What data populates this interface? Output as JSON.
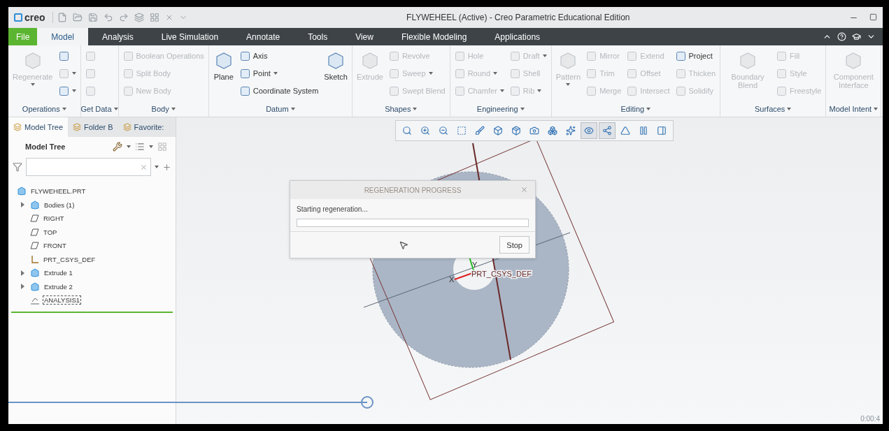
{
  "window": {
    "logo": "creo",
    "title": "FLYWEHEEL (Active) - Creo Parametric Educational Edition"
  },
  "tabs": [
    {
      "label": "File",
      "kind": "file",
      "selected": false
    },
    {
      "label": "Model",
      "kind": "tab",
      "selected": true
    },
    {
      "label": "Analysis",
      "kind": "tab",
      "selected": false
    },
    {
      "label": "Live Simulation",
      "kind": "tab",
      "selected": false
    },
    {
      "label": "Annotate",
      "kind": "tab",
      "selected": false
    },
    {
      "label": "Tools",
      "kind": "tab",
      "selected": false
    },
    {
      "label": "View",
      "kind": "tab",
      "selected": false
    },
    {
      "label": "Flexible Modeling",
      "kind": "tab",
      "selected": false
    },
    {
      "label": "Applications",
      "kind": "tab",
      "selected": false
    }
  ],
  "ribbon": [
    {
      "label": "Operations",
      "columns": [
        [
          {
            "label": "Regenerate",
            "kind": "large",
            "disabled": true,
            "dropdown": true
          }
        ],
        [
          {
            "kind": "icon",
            "disabled": false,
            "dropdown": false
          },
          {
            "kind": "icon",
            "disabled": true,
            "dropdown": true
          },
          {
            "kind": "icon",
            "disabled": false,
            "dropdown": true
          }
        ]
      ]
    },
    {
      "label": "Get Data",
      "columns": [
        [
          {
            "kind": "icon",
            "disabled": true,
            "dropdown": false
          },
          {
            "kind": "icon",
            "disabled": true,
            "dropdown": false
          },
          {
            "kind": "icon",
            "disabled": true,
            "dropdown": false
          }
        ]
      ]
    },
    {
      "label": "Body",
      "columns": [
        [
          {
            "label": "Boolean Operations",
            "kind": "small",
            "disabled": true,
            "dropdown": false
          },
          {
            "label": "Split Body",
            "kind": "small",
            "disabled": true,
            "dropdown": false
          },
          {
            "label": "New Body",
            "kind": "small",
            "disabled": true,
            "dropdown": false
          }
        ]
      ]
    },
    {
      "label": "Datum",
      "columns": [
        [
          {
            "label": "Plane",
            "kind": "large",
            "disabled": false,
            "dropdown": false
          }
        ],
        [
          {
            "label": "Axis",
            "kind": "small",
            "disabled": false,
            "dropdown": false
          },
          {
            "label": "Point",
            "kind": "small",
            "disabled": false,
            "dropdown": true
          },
          {
            "label": "Coordinate System",
            "kind": "small",
            "disabled": false,
            "dropdown": false
          }
        ],
        [
          {
            "label": "Sketch",
            "kind": "large",
            "disabled": false,
            "dropdown": false
          }
        ]
      ]
    },
    {
      "label": "Shapes",
      "columns": [
        [
          {
            "label": "Extrude",
            "kind": "large",
            "disabled": true,
            "dropdown": false
          }
        ],
        [
          {
            "label": "Revolve",
            "kind": "small",
            "disabled": true,
            "dropdown": false
          },
          {
            "label": "Sweep",
            "kind": "small",
            "disabled": true,
            "dropdown": true
          },
          {
            "label": "Swept Blend",
            "kind": "small",
            "disabled": true,
            "dropdown": false
          }
        ]
      ]
    },
    {
      "label": "Engineering",
      "columns": [
        [
          {
            "label": "Hole",
            "kind": "small",
            "disabled": true,
            "dropdown": false
          },
          {
            "label": "Round",
            "kind": "small",
            "disabled": true,
            "dropdown": true
          },
          {
            "label": "Chamfer",
            "kind": "small",
            "disabled": true,
            "dropdown": true
          }
        ],
        [
          {
            "label": "Draft",
            "kind": "small",
            "disabled": true,
            "dropdown": true
          },
          {
            "label": "Shell",
            "kind": "small",
            "disabled": true,
            "dropdown": false
          },
          {
            "label": "Rib",
            "kind": "small",
            "disabled": true,
            "dropdown": true
          }
        ]
      ]
    },
    {
      "label": "Editing",
      "columns": [
        [
          {
            "label": "Pattern",
            "kind": "large",
            "disabled": true,
            "dropdown": true
          }
        ],
        [
          {
            "label": "Mirror",
            "kind": "small",
            "disabled": true,
            "dropdown": false
          },
          {
            "label": "Trim",
            "kind": "small",
            "disabled": true,
            "dropdown": false
          },
          {
            "label": "Merge",
            "kind": "small",
            "disabled": true,
            "dropdown": false
          }
        ],
        [
          {
            "label": "Extend",
            "kind": "small",
            "disabled": true,
            "dropdown": false
          },
          {
            "label": "Offset",
            "kind": "small",
            "disabled": true,
            "dropdown": false
          },
          {
            "label": "Intersect",
            "kind": "small",
            "disabled": true,
            "dropdown": false
          }
        ],
        [
          {
            "label": "Project",
            "kind": "small",
            "disabled": false,
            "dropdown": false
          },
          {
            "label": "Thicken",
            "kind": "small",
            "disabled": true,
            "dropdown": false
          },
          {
            "label": "Solidify",
            "kind": "small",
            "disabled": true,
            "dropdown": false
          }
        ]
      ]
    },
    {
      "label": "Surfaces",
      "columns": [
        [
          {
            "label": "Boundary Blend",
            "kind": "large",
            "disabled": true,
            "dropdown": false
          }
        ],
        [
          {
            "label": "Fill",
            "kind": "small",
            "disabled": true,
            "dropdown": false
          },
          {
            "label": "Style",
            "kind": "small",
            "disabled": true,
            "dropdown": false
          },
          {
            "label": "Freestyle",
            "kind": "small",
            "disabled": true,
            "dropdown": false
          }
        ]
      ]
    },
    {
      "label": "Model Intent",
      "columns": [
        [
          {
            "label": "Component Interface",
            "kind": "large",
            "disabled": true,
            "dropdown": false
          }
        ]
      ]
    }
  ],
  "panel_tabs": [
    {
      "label": "Model Tree",
      "selected": true
    },
    {
      "label": "Folder B",
      "selected": false
    },
    {
      "label": "Favorite:",
      "selected": false
    }
  ],
  "tree_header": "Model Tree",
  "tree": {
    "label": "FLYWEHEEL.PRT",
    "kind": "part",
    "children": [
      {
        "label": "Bodies (1)",
        "kind": "bodies",
        "expandable": true,
        "focused": false
      },
      {
        "label": "RIGHT",
        "kind": "plane",
        "expandable": false,
        "focused": false
      },
      {
        "label": "TOP",
        "kind": "plane",
        "expandable": false,
        "focused": false
      },
      {
        "label": "FRONT",
        "kind": "plane",
        "expandable": false,
        "focused": false
      },
      {
        "label": "PRT_CSYS_DEF",
        "kind": "csys",
        "expandable": false,
        "focused": false
      },
      {
        "label": "Extrude 1",
        "kind": "feature",
        "expandable": true,
        "focused": false
      },
      {
        "label": "Extrude 2",
        "kind": "feature",
        "expandable": true,
        "focused": false
      },
      {
        "label": "ANALYSIS1",
        "kind": "analysis",
        "expandable": false,
        "focused": true
      }
    ]
  },
  "view_toolbar": [
    {
      "selected": false
    },
    {
      "selected": false
    },
    {
      "selected": false
    },
    {
      "selected": false
    },
    {
      "selected": false
    },
    {
      "selected": false
    },
    {
      "selected": false
    },
    {
      "selected": false
    },
    {
      "selected": false
    },
    {
      "selected": false
    },
    {
      "selected": true
    },
    {
      "selected": true
    },
    {
      "selected": false
    },
    {
      "selected": false
    },
    {
      "selected": false
    }
  ],
  "model_view": {
    "csys_label": "PRT_CSYS_DEF",
    "x_label": "X",
    "y_label": "Y"
  },
  "dialog": {
    "title": "REGENERATION PROGRESS",
    "message": "Starting regeneration...",
    "level": 0,
    "button": "Stop"
  },
  "video": {
    "level": 0.41,
    "time": "0:00:4"
  }
}
